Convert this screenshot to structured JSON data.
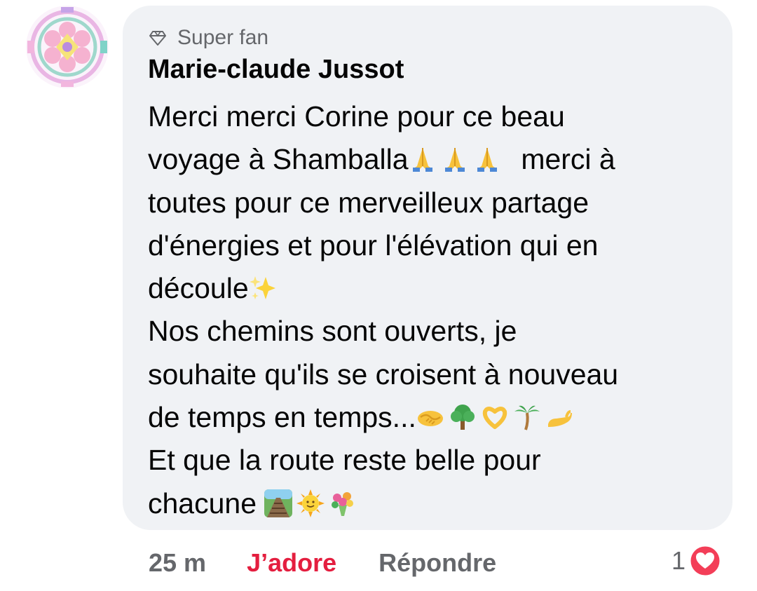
{
  "comment": {
    "badge_label": "Super fan",
    "badge_icon": "diamond-icon",
    "author": "Marie-claude Jussot",
    "lines": [
      "Merci merci Corine pour ce beau",
      "voyage à  Shamballa",
      "merci à",
      "toutes pour ce merveilleux partage",
      "d'énergies et pour l'élévation qui en",
      "découle",
      "Nos chemins sont ouverts, je",
      "souhaite qu'ils se croisent à nouveau",
      "de temps en temps...",
      "Et que la route reste belle pour",
      "chacune"
    ],
    "emojis": {
      "prayer": "folded-hands-emoji",
      "sparkles": "sparkles-emoji",
      "handshake": "handshake-emoji",
      "tree": "deciduous-tree-emoji",
      "heart_hands": "heart-hands-emoji",
      "palm": "palm-tree-emoji",
      "palm_up": "palm-up-hand-emoji",
      "railway": "railway-track-emoji",
      "sun": "sun-with-face-emoji",
      "bouquet": "bouquet-emoji"
    }
  },
  "actions": {
    "time": "25 m",
    "like_label": "J’adore",
    "reply_label": "Répondre"
  },
  "reactions": {
    "count": "1",
    "icon": "love-reaction-icon"
  },
  "colors": {
    "bubble_bg": "#f0f2f5",
    "like_red": "#e41e3f",
    "meta_gray": "#65676b",
    "text_black": "#050505"
  }
}
